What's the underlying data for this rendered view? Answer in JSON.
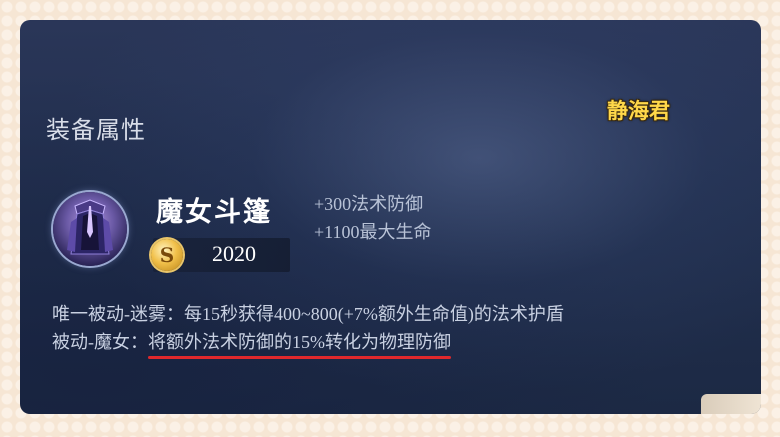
{
  "section_title": "装备属性",
  "watermark": "静海君",
  "item": {
    "name": "魔女斗篷",
    "price": "2020",
    "coin_glyph": "S",
    "icon": "cloak-icon",
    "stats": [
      "+300法术防御",
      "+1100最大生命"
    ]
  },
  "passives": [
    {
      "text": "唯一被动-迷雾：每15秒获得400~800(+7%额外生命值)的法术护盾"
    },
    {
      "prefix": "被动-魔女：",
      "highlight": "将额外法术防御的15%转化为物理防御"
    }
  ],
  "colors": {
    "underline": "#e0282c",
    "watermark": "#ffd84a",
    "panel": "#22304f"
  }
}
